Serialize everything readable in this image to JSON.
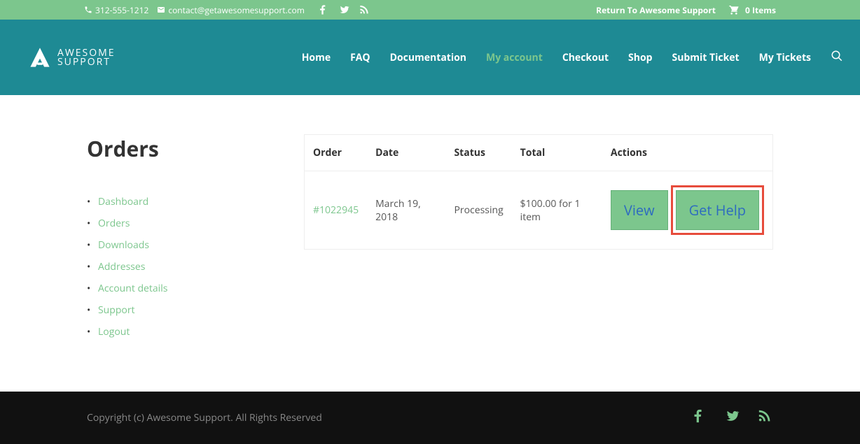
{
  "topbar": {
    "phone": "312-555-1212",
    "email": "contact@getawesomesupport.com",
    "return_link": "Return To Awesome Support",
    "cart_label": "0 Items"
  },
  "logo": {
    "line1": "AWESOME",
    "line2": "SUPPORT"
  },
  "nav": {
    "items": [
      {
        "label": "Home"
      },
      {
        "label": "FAQ"
      },
      {
        "label": "Documentation"
      },
      {
        "label": "My account",
        "active": true
      },
      {
        "label": "Checkout"
      },
      {
        "label": "Shop"
      },
      {
        "label": "Submit Ticket"
      },
      {
        "label": "My Tickets"
      }
    ]
  },
  "page": {
    "title": "Orders"
  },
  "sidebar": {
    "items": [
      {
        "label": "Dashboard"
      },
      {
        "label": "Orders"
      },
      {
        "label": "Downloads"
      },
      {
        "label": "Addresses"
      },
      {
        "label": "Account details"
      },
      {
        "label": "Support"
      },
      {
        "label": "Logout"
      }
    ]
  },
  "orders_table": {
    "headers": {
      "order": "Order",
      "date": "Date",
      "status": "Status",
      "total": "Total",
      "actions": "Actions"
    },
    "rows": [
      {
        "order": "#1022945",
        "date": "March 19, 2018",
        "status": "Processing",
        "total": "$100.00 for 1 item",
        "actions": {
          "view": "View",
          "help": "Get Help"
        }
      }
    ]
  },
  "footer": {
    "copy": "Copyright (c) Awesome Support. All Rights Reserved"
  }
}
